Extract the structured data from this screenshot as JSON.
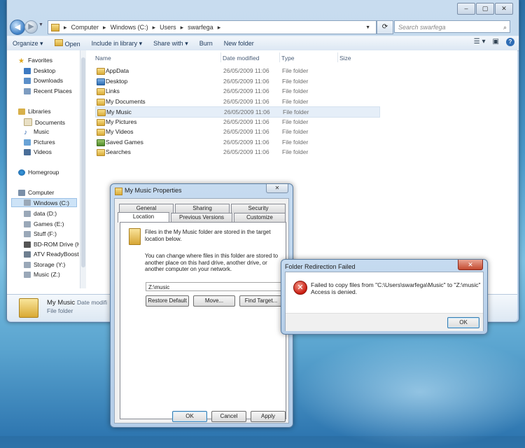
{
  "explorer": {
    "caption_buttons": [
      "–",
      "▢",
      "✕"
    ],
    "address_parts": [
      "Computer",
      "Windows (C:)",
      "Users",
      "swarfega"
    ],
    "search_placeholder": "Search swarfega",
    "toolbar": [
      "Organize",
      "Open",
      "Include in library",
      "Share with",
      "Burn",
      "New folder"
    ],
    "nav": {
      "favorites": {
        "header": "Favorites",
        "items": [
          "Desktop",
          "Downloads",
          "Recent Places"
        ]
      },
      "libraries": {
        "header": "Libraries",
        "items": [
          "Documents",
          "Music",
          "Pictures",
          "Videos"
        ]
      },
      "homegroup": "Homegroup",
      "computer": {
        "header": "Computer",
        "items": [
          "Windows (C:)",
          "data (D:)",
          "Games (E:)",
          "Stuff (F:)",
          "BD-ROM Drive (H",
          "ATV ReadyBoost",
          "Storage (Y:)",
          "Music (Z:)"
        ]
      }
    },
    "columns": [
      "Name",
      "Date modified",
      "Type",
      "Size"
    ],
    "files": [
      {
        "name": "AppData",
        "date": "26/05/2009 11:06",
        "type": "File folder"
      },
      {
        "name": "Desktop",
        "date": "26/05/2009 11:06",
        "type": "File folder"
      },
      {
        "name": "Links",
        "date": "26/05/2009 11:06",
        "type": "File folder"
      },
      {
        "name": "My Documents",
        "date": "26/05/2009 11:06",
        "type": "File folder"
      },
      {
        "name": "My Music",
        "date": "26/05/2009 11:06",
        "type": "File folder"
      },
      {
        "name": "My Pictures",
        "date": "26/05/2009 11:06",
        "type": "File folder"
      },
      {
        "name": "My Videos",
        "date": "26/05/2009 11:06",
        "type": "File folder"
      },
      {
        "name": "Saved Games",
        "date": "26/05/2009 11:06",
        "type": "File folder"
      },
      {
        "name": "Searches",
        "date": "26/05/2009 11:06",
        "type": "File folder"
      }
    ],
    "details": {
      "name": "My Music",
      "date_label": "Date modifi",
      "type": "File folder"
    }
  },
  "properties": {
    "title": "My Music Properties",
    "close": "✕",
    "tabs_row1": [
      "General",
      "Sharing",
      "Security"
    ],
    "tabs_row2": [
      "Location",
      "Previous Versions",
      "Customize"
    ],
    "text1": "Files in the My Music folder are stored in the target location below.",
    "text2": "You can change where files in this folder are stored to another place on this hard drive, another drive, or another computer on your network.",
    "path": "Z:\\music",
    "buttons": [
      "Restore Default",
      "Move...",
      "Find Target..."
    ],
    "footer": [
      "OK",
      "Cancel",
      "Apply"
    ]
  },
  "error": {
    "title": "Folder Redirection Failed",
    "close": "✕",
    "icon": "error-x-icon",
    "message_line1": "Failed to copy files from \"C:\\Users\\swarfega\\Music\" to \"Z:\\music\"",
    "message_line2": "Access is denied.",
    "ok": "OK"
  }
}
